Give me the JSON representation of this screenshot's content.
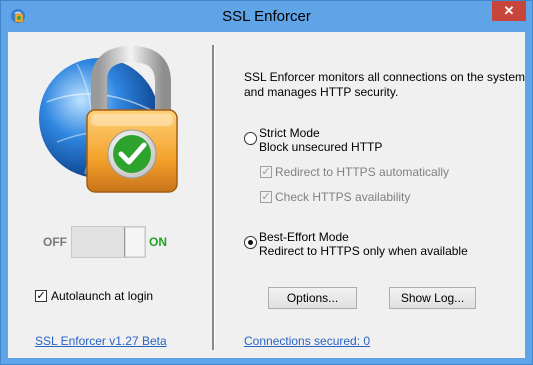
{
  "window": {
    "title": "SSL Enforcer",
    "close_label": "✕"
  },
  "left": {
    "toggle_off_label": "OFF",
    "toggle_on_label": "ON",
    "toggle_state": "on",
    "autolaunch_label": "Autolaunch at login",
    "autolaunch_checked": true,
    "version_link": "SSL Enforcer v1.27 Beta"
  },
  "right": {
    "description_line1": "SSL Enforcer monitors all connections on the system",
    "description_line2": "and manages HTTP security.",
    "strict_mode": {
      "title": "Strict Mode",
      "subtitle": "Block unsecured HTTP",
      "selected": false
    },
    "redirect_https_label": "Redirect to HTTPS automatically",
    "check_https_label": "Check HTTPS availability",
    "best_effort_mode": {
      "title": "Best-Effort Mode",
      "subtitle": "Redirect to HTTPS only when available",
      "selected": true
    },
    "options_button": "Options...",
    "show_log_button": "Show Log...",
    "connections_link": "Connections secured: 0"
  },
  "colors": {
    "accent_link": "#2a63c6",
    "on_green": "#21a021",
    "close_red": "#c7453b"
  }
}
